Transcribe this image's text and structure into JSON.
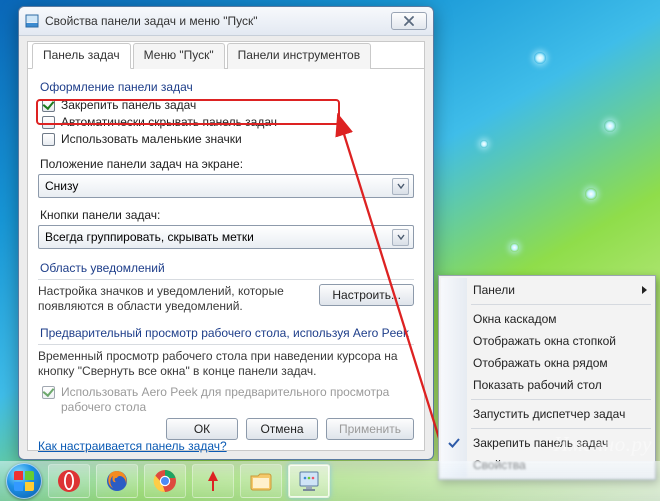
{
  "dialog": {
    "title": "Свойства панели задач и меню \"Пуск\"",
    "tabs": [
      "Панель задач",
      "Меню \"Пуск\"",
      "Панели инструментов"
    ],
    "group_appearance": "Оформление панели задач",
    "chk_lock": "Закрепить панель задач",
    "chk_autohide": "Автоматически скрывать панель задач",
    "chk_small": "Использовать маленькие значки",
    "position_label": "Положение панели задач на экране:",
    "position_value": "Снизу",
    "buttons_label": "Кнопки панели задач:",
    "buttons_value": "Всегда группировать, скрывать метки",
    "group_notif": "Область уведомлений",
    "notif_desc": "Настройка значков и уведомлений, которые появляются в области уведомлений.",
    "notif_btn": "Настроить...",
    "group_aero": "Предварительный просмотр рабочего стола, используя Aero Peek",
    "aero_desc": "Временный просмотр рабочего стола при наведении курсора на кнопку \"Свернуть все окна\" в конце панели задач.",
    "chk_aero": "Использовать Aero Peek для предварительного просмотра рабочего стола",
    "link": "Как настраивается панель задач?",
    "ok": "ОК",
    "cancel": "Отмена",
    "apply": "Применить"
  },
  "contextmenu": {
    "panels": "Панели",
    "cascade": "Окна каскадом",
    "stack": "Отображать окна стопкой",
    "side": "Отображать окна рядом",
    "show_desktop": "Показать рабочий стол",
    "taskmgr": "Запустить диспетчер задач",
    "lock": "Закрепить панель задач",
    "props": "Свойства"
  },
  "taskbar_icons": [
    "start",
    "opera",
    "firefox",
    "chrome",
    "yandex",
    "explorer",
    "control-panel"
  ],
  "watermark": "Именно.ру"
}
